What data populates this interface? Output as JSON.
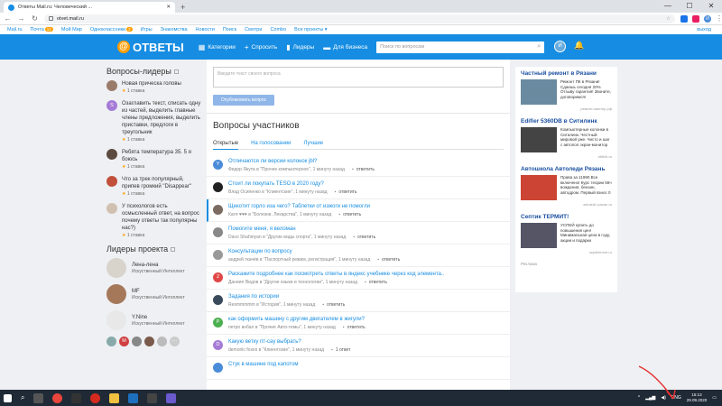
{
  "browser": {
    "tab_title": "Ответы Mail.ru: Человеческий ...",
    "url": "otvet.mail.ru",
    "window_controls": [
      "—",
      "☐",
      "✕"
    ],
    "profile_initial": "И"
  },
  "mailbar": {
    "items": [
      {
        "label": "Mail.ru"
      },
      {
        "label": "Почта",
        "badge": "12"
      },
      {
        "label": "Мой Мир"
      },
      {
        "label": "Одноклассники",
        "badge": "2"
      },
      {
        "label": "Игры"
      },
      {
        "label": "Знакомства"
      },
      {
        "label": "Новости"
      },
      {
        "label": "Поиск"
      },
      {
        "label": "Смотри"
      },
      {
        "label": "Combo"
      },
      {
        "label": "Все проекты ▾"
      }
    ],
    "exit": "выход"
  },
  "header": {
    "logo": "ОТВЕТЫ",
    "nav": [
      {
        "icon": "▦",
        "label": "Категории"
      },
      {
        "icon": "+",
        "label": "Спросить"
      },
      {
        "icon": "▮",
        "label": "Лидеры"
      },
      {
        "icon": "▬",
        "label": "Для бизнеса"
      }
    ],
    "search_placeholder": "Поиск по вопросам",
    "avatar_initial": "И"
  },
  "left": {
    "leaders_title": "Вопросы-лидеры",
    "questions": [
      {
        "text": "Новая прическа головы",
        "stake": "1 ставка",
        "color": "#9a7b6a"
      },
      {
        "text": "Озаглавить текст, списать одну из частей, выделить главные члены предложения, выделить приставки, предлоги в треугольник",
        "stake": "1 ставка",
        "color": "#a57bd6",
        "initial": "S"
      },
      {
        "text": "Ребята температура 35. 5 я боюсь",
        "stake": "1 ставка",
        "color": "#5b4a40"
      },
      {
        "text": "Что за трек популярный, припев громкий \"Disappear\"",
        "stake": "1 ставка",
        "color": "#c0503a"
      },
      {
        "text": "У психологов есть осмысленный ответ, на вопрос почему ответы так популярны нас?)",
        "stake": "1 ставка",
        "color": "#d0c0b0"
      }
    ],
    "project_leaders_title": "Лидеры проекта",
    "leaders": [
      {
        "name": "Лена-лена",
        "role": "Искуственный Интеллект",
        "color": "#d8d4cc"
      },
      {
        "name": "MF",
        "role": "Искуственный Интеллект",
        "color": "#a6785a"
      },
      {
        "name": "Y.Nine",
        "role": "Искуственный Интеллект",
        "color": "#e8e8e8"
      }
    ],
    "small_avatars": [
      {
        "color": "#8aa"
      },
      {
        "color": "#d04040",
        "initial": "М"
      },
      {
        "color": "#888"
      },
      {
        "color": "#7a5a4a"
      },
      {
        "color": "#bbb"
      },
      {
        "color": "#ccc",
        "initial": "···"
      }
    ]
  },
  "main": {
    "ask_placeholder": "Введите текст своего вопроса",
    "publish_label": "Опубликовать вопрос",
    "section_title": "Вопросы участников",
    "tabs": [
      "Открытые",
      "На голосовании",
      "Лучшие"
    ],
    "questions": [
      {
        "title": "Отличаются ли версии колонок jbl?",
        "meta": "Федор Якута в \"Прочее компьютерное\", 1 минуту назад",
        "answer": "ответить",
        "color": "#4a8cd8",
        "initial": "Y"
      },
      {
        "title": "Стоит ли покупать ТЕSО в 2020 году?",
        "meta": "Влад Осипенко в \"Клиентские\", 1 минуту назад",
        "answer": "ответить",
        "color": "#222"
      },
      {
        "title": "Щекотит горло иза чего? Таблетки от изжоги не помогли",
        "meta": "Катя ♥♥♥ в \"Болезни, Лекарства\", 1 минуту назад",
        "answer": "ответить",
        "color": "#7a6a60"
      },
      {
        "title": "Помогите меня, я веломан",
        "meta": "Davo Shahinyan в \"Другие виды спорта\", 1 минуту назад",
        "answer": "ответить",
        "color": "#888"
      },
      {
        "title": "Консультации по вопросу",
        "meta": "андрей ткачёв в \"Паспортный режим, регистрация\", 1 минуту назад",
        "answer": "ответить",
        "color": "#999"
      },
      {
        "title": "Раскажите подробнее как посмотреть ответы в яндекс учебнике через код элемента..",
        "meta": "Даниил Видов в \"Другие языки и технологии\", 1 минуту назад",
        "answer": "ответить",
        "color": "#e04848",
        "initial": "2"
      },
      {
        "title": "Задания по истории",
        "meta": "Resmmmmm в \"История\", 1 минуту назад",
        "answer": "ответить",
        "color": "#3a4a5a"
      },
      {
        "title": "как оформить машину с другим двигателем в жигули?",
        "meta": "петро внбал в \"Прочие Авто-темы\", 1 минуту назад",
        "answer": "ответить",
        "color": "#4caf50",
        "initial": "P"
      },
      {
        "title": "Какую ветку пт-сау выбрать?",
        "meta": "demonic foxes в \"Клиентские\", 1 минуту назад",
        "answer": "1 ответ",
        "color": "#a57bd6",
        "initial": "D"
      },
      {
        "title": "Стук в машине под капотом",
        "meta": "",
        "answer": "",
        "color": "#4a8cd8"
      }
    ]
  },
  "ads": [
    {
      "title": "Частный ремонт в Рязани",
      "text": "Ремонт ПК в Рязани! Сдаешь сегодня 20% Отзыву гарантия! Звоните, договоримся!",
      "source": "ремонт-мастер.рф",
      "color": "#6a8aa0"
    },
    {
      "title": "Edifier 5360DB в Ситилинк",
      "text": "Компьютерные колонки в Ситилинк. Честный мировой уже. Чисто и шаг с автопоп экран-монитор",
      "source": "citilink.ru",
      "color": "#444"
    },
    {
      "title": "Автошкола Автоледи Рязань",
      "text": "Права за 11990 Все включено! Курс теории 56ч вождения, бензин, автодром. Первый взнос 0",
      "source": "avtoledi-ryazan.ru",
      "color": "#c43"
    },
    {
      "title": "Септик ТЕРМИТ!",
      "text": "УСПЕЙ купить до повышения цен! Минимальная цена в году, акции и подарки",
      "source": "septiktermit.ru",
      "color": "#556"
    }
  ],
  "ads_label": "Реклама",
  "taskbar": {
    "lang": "ENG",
    "time": "15:13",
    "date": "29.09.2020"
  }
}
